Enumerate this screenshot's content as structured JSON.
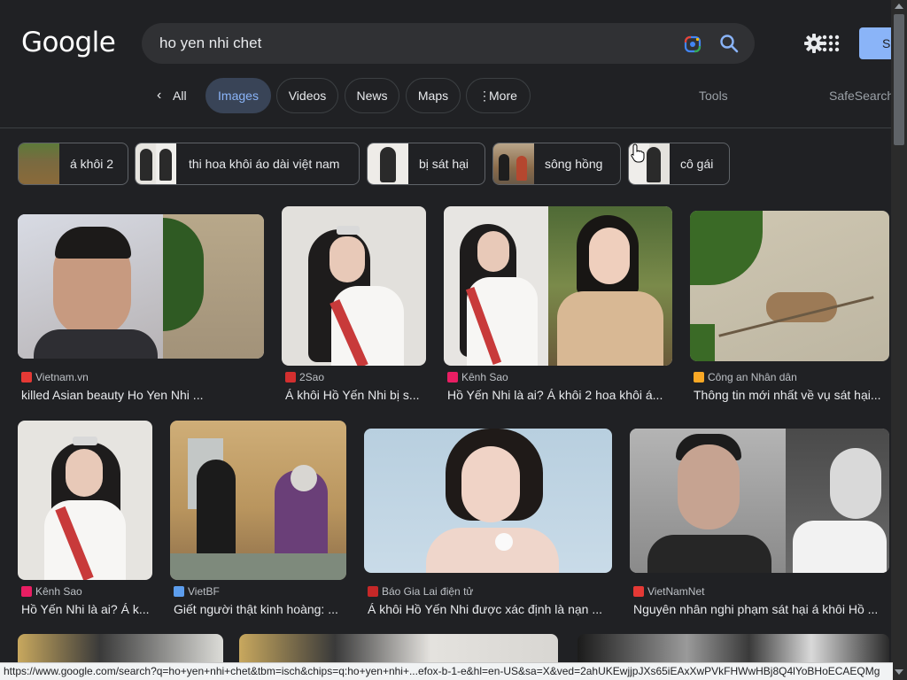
{
  "header": {
    "logo": "Google",
    "query": "ho yen nhi chet",
    "signin_label": "Si",
    "icons": [
      "google-lens-icon",
      "search-icon",
      "settings-gear-icon",
      "apps-grid-icon"
    ]
  },
  "nav": {
    "all_label": "All",
    "tabs": [
      "Images",
      "Videos",
      "News",
      "Maps",
      "More"
    ],
    "tools_label": "Tools",
    "safesearch_label": "SafeSearch"
  },
  "chips": [
    "á khôi 2",
    "thi hoa khôi áo dài việt nam",
    "bị sát hại",
    "sông hồng",
    "cô gái"
  ],
  "results": [
    {
      "source": "Vietnam.vn",
      "title": "killed Asian beauty Ho Yen Nhi ...",
      "favicon_color": "#e53935"
    },
    {
      "source": "2Sao",
      "title": "Á khôi Hồ Yến Nhi bị s...",
      "favicon_color": "#d32f2f"
    },
    {
      "source": "Kênh Sao",
      "title": "Hồ Yến Nhi là ai? Á khôi 2 hoa khôi á...",
      "favicon_color": "#e91e63"
    },
    {
      "source": "Công an Nhân dân",
      "title": "Thông tin mới nhất về vụ sát hại...",
      "favicon_color": "#f9a825"
    },
    {
      "source": "Kênh Sao",
      "title": "Hồ Yến Nhi là ai? Á k...",
      "favicon_color": "#e91e63"
    },
    {
      "source": "VietBF",
      "title": "Giết người thật kinh hoàng: ...",
      "favicon_color": "#5c9ded"
    },
    {
      "source": "Báo Gia Lai điện tử",
      "title": "Á khôi Hồ Yến Nhi được xác định là nạn ...",
      "favicon_color": "#c62828"
    },
    {
      "source": "VietNamNet",
      "title": "Nguyên nhân nghi phạm sát hại á khôi Hồ ...",
      "favicon_color": "#e53935"
    }
  ],
  "status_url": "https://www.google.com/search?q=ho+yen+nhi+chet&tbm=isch&chips=q:ho+yen+nhi+...efox-b-1-e&hl=en-US&sa=X&ved=2ahUKEwjjpJXs65iEAxXwPVkFHWwHBj8Q4lYoBHoECAEQMg"
}
